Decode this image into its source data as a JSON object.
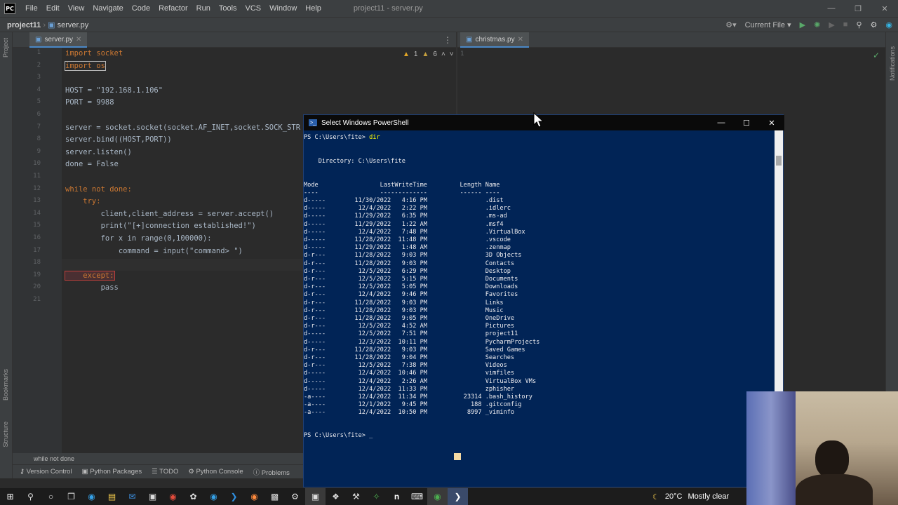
{
  "titlebar": {
    "logo": "PC",
    "menu": [
      "File",
      "Edit",
      "View",
      "Navigate",
      "Code",
      "Refactor",
      "Run",
      "Tools",
      "VCS",
      "Window",
      "Help"
    ],
    "window_title": "project11 - server.py"
  },
  "navbar": {
    "project": "project11",
    "file": "server.py",
    "run_config": "Current File"
  },
  "left_strip": {
    "project_label": "Project",
    "bookmarks_label": "Bookmarks",
    "structure_label": "Structure"
  },
  "right_strip": {
    "notifications_label": "Notifications"
  },
  "editor_left": {
    "tab_label": "server.py",
    "inspection": {
      "warnings": "1",
      "weak_warnings": "6"
    },
    "line_numbers": [
      "1",
      "2",
      "3",
      "4",
      "5",
      "6",
      "7",
      "8",
      "9",
      "10",
      "11",
      "12",
      "13",
      "14",
      "15",
      "16",
      "17",
      "18",
      "19",
      "20",
      "21"
    ],
    "lines": [
      "import socket",
      "import os",
      "",
      "HOST = \"192.168.1.106\"",
      "PORT = 9988",
      "",
      "server = socket.socket(socket.AF_INET,socket.SOCK_STR",
      "server.bind((HOST,PORT))",
      "server.listen()",
      "done = False",
      "",
      "while not done:",
      "    try:",
      "        client,client_address = server.accept()",
      "        print(\"[+]connection established!\")",
      "        for x in range(0,100000):",
      "            command = input(\"command> \")",
      "",
      "    except:",
      "        pass",
      ""
    ]
  },
  "editor_right": {
    "tab_label": "christmas.py",
    "line_numbers": [
      "1"
    ]
  },
  "status": {
    "message": "while not done",
    "tools": [
      "Version Control",
      "Python Packages",
      "TODO",
      "Python Console",
      "Problems"
    ]
  },
  "powershell": {
    "title": "Select Windows PowerShell",
    "prompt1": "PS C:\\Users\\fite> ",
    "command": "dir",
    "directory_line": "    Directory: C:\\Users\\fite",
    "header": "Mode                 LastWriteTime         Length Name",
    "underline": "----                 -------------         ------ ----",
    "rows": [
      "d-----        11/30/2022   4:16 PM                .dist",
      "d-----         12/4/2022   2:22 PM                .idlerc",
      "d-----        11/29/2022   6:35 PM                .ms-ad",
      "d-----        11/29/2022   1:22 AM                .msf4",
      "d-----         12/4/2022   7:48 PM                .VirtualBox",
      "d-----        11/28/2022  11:48 PM                .vscode",
      "d-----        11/29/2022   1:48 AM                .zenmap",
      "d-r---        11/28/2022   9:03 PM                3D Objects",
      "d-r---        11/28/2022   9:03 PM                Contacts",
      "d-r---         12/5/2022   6:29 PM                Desktop",
      "d-r---         12/5/2022   5:15 PM                Documents",
      "d-r---         12/5/2022   5:05 PM                Downloads",
      "d-r---         12/4/2022   9:46 PM                Favorites",
      "d-r---        11/28/2022   9:03 PM                Links",
      "d-r---        11/28/2022   9:03 PM                Music",
      "d-r---        11/28/2022   9:05 PM                OneDrive",
      "d-r---         12/5/2022   4:52 AM                Pictures",
      "d-----         12/5/2022   7:51 PM                project11",
      "d-----         12/3/2022  10:11 PM                PycharmProjects",
      "d-r---        11/28/2022   9:03 PM                Saved Games",
      "d-r---        11/28/2022   9:04 PM                Searches",
      "d-r---         12/5/2022   7:38 PM                Videos",
      "d-----         12/4/2022  10:46 PM                vimfiles",
      "d-----         12/4/2022   2:26 AM                VirtualBox VMs",
      "d-----         12/4/2022  11:33 PM                zphisher",
      "-a----         12/4/2022  11:34 PM          23314 .bash_history",
      "-a----         12/1/2022   9:45 PM            188 .gitconfig",
      "-a----         12/4/2022  10:50 PM           8997 _viminfo"
    ],
    "prompt2": "PS C:\\Users\\fite> "
  },
  "taskbar": {
    "weather_temp": "20°C",
    "weather_desc": "Mostly clear"
  }
}
